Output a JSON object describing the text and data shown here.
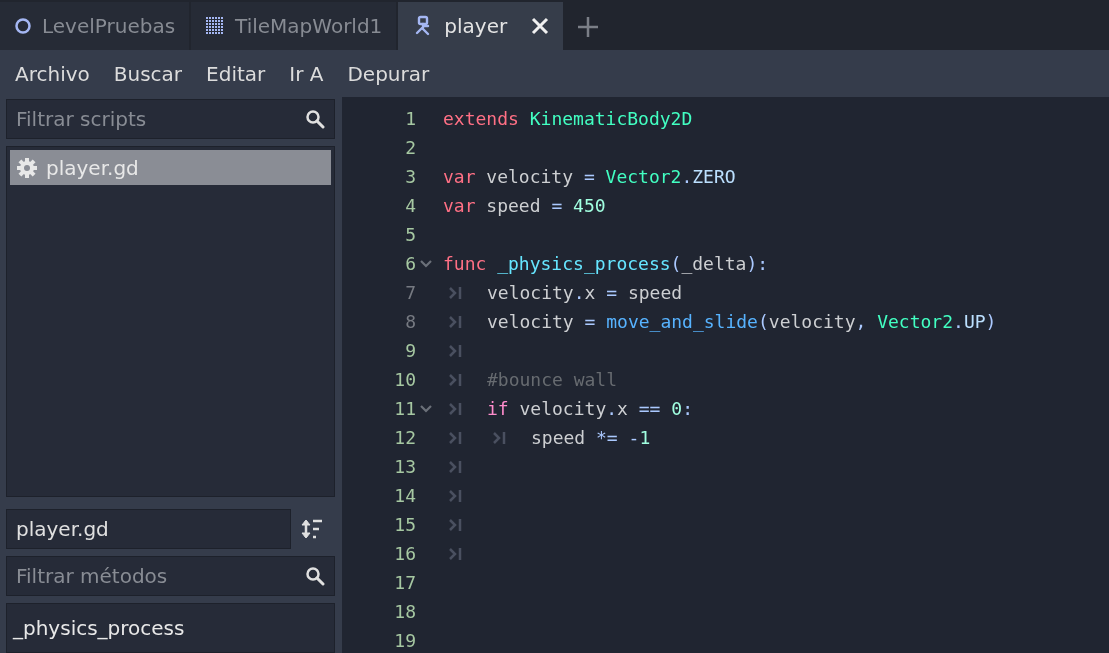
{
  "tabs": [
    {
      "label": "LevelPruebas",
      "selected": false
    },
    {
      "label": "TileMapWorld1",
      "selected": false
    },
    {
      "label": "player",
      "selected": true
    }
  ],
  "menu": [
    "Archivo",
    "Buscar",
    "Editar",
    "Ir A",
    "Depurar"
  ],
  "scripts_panel": {
    "filter": {
      "placeholder": "Filtrar scripts"
    },
    "items": [
      {
        "label": "player.gd",
        "selected": true
      }
    ]
  },
  "methods_panel": {
    "current_script": "player.gd",
    "filter": {
      "placeholder": "Filtrar métodos"
    },
    "items": [
      {
        "label": "_physics_process",
        "selected": false
      }
    ]
  },
  "editor": {
    "lines": [
      {
        "number": "1",
        "foldable": false,
        "dimmed": false,
        "tokens": [
          {
            "kind": "keyword",
            "text": "extends "
          },
          {
            "kind": "type",
            "text": "KinematicBody2D"
          }
        ]
      },
      {
        "number": "2",
        "foldable": false,
        "dimmed": false
      },
      {
        "number": "3",
        "foldable": false,
        "dimmed": false,
        "tokens": [
          {
            "kind": "keyword",
            "text": "var"
          },
          {
            "kind": "text",
            "text": " velocity "
          },
          {
            "kind": "symbol",
            "text": "= "
          },
          {
            "kind": "type",
            "text": "Vector2"
          },
          {
            "kind": "symbol",
            "text": "."
          },
          {
            "kind": "member",
            "text": "ZERO"
          }
        ]
      },
      {
        "number": "4",
        "foldable": false,
        "dimmed": false,
        "tokens": [
          {
            "kind": "keyword",
            "text": "var"
          },
          {
            "kind": "text",
            "text": " speed "
          },
          {
            "kind": "symbol",
            "text": "= "
          },
          {
            "kind": "number",
            "text": "450"
          }
        ]
      },
      {
        "number": "5",
        "foldable": false,
        "dimmed": false
      },
      {
        "number": "6",
        "foldable": true,
        "dimmed": false,
        "tokens": [
          {
            "kind": "keyword",
            "text": "func "
          },
          {
            "kind": "member_function",
            "text": "_physics_process"
          },
          {
            "kind": "symbol",
            "text": "("
          },
          {
            "kind": "text",
            "text": "_delta"
          },
          {
            "kind": "symbol",
            "text": "):"
          }
        ]
      },
      {
        "number": "7",
        "foldable": false,
        "dimmed": true,
        "tokens": [
          {
            "kind": "tab"
          },
          {
            "kind": "text",
            "text": "velocity"
          },
          {
            "kind": "symbol",
            "text": "."
          },
          {
            "kind": "text",
            "text": "x "
          },
          {
            "kind": "symbol",
            "text": "="
          },
          {
            "kind": "text",
            "text": " speed"
          }
        ]
      },
      {
        "number": "8",
        "foldable": false,
        "dimmed": true,
        "tokens": [
          {
            "kind": "tab"
          },
          {
            "kind": "text",
            "text": "velocity "
          },
          {
            "kind": "symbol",
            "text": "= "
          },
          {
            "kind": "function",
            "text": "move_and_slide"
          },
          {
            "kind": "symbol",
            "text": "("
          },
          {
            "kind": "text",
            "text": "velocity"
          },
          {
            "kind": "symbol",
            "text": ", "
          },
          {
            "kind": "type",
            "text": "Vector2"
          },
          {
            "kind": "symbol",
            "text": "."
          },
          {
            "kind": "member",
            "text": "UP"
          },
          {
            "kind": "symbol",
            "text": ")"
          }
        ]
      },
      {
        "number": "9",
        "foldable": false,
        "dimmed": false,
        "tokens": [
          {
            "kind": "tab"
          }
        ]
      },
      {
        "number": "10",
        "foldable": false,
        "dimmed": false,
        "tokens": [
          {
            "kind": "tab"
          },
          {
            "kind": "comment",
            "text": "#bounce wall"
          }
        ]
      },
      {
        "number": "11",
        "foldable": true,
        "dimmed": false,
        "tokens": [
          {
            "kind": "tab"
          },
          {
            "kind": "control",
            "text": "if"
          },
          {
            "kind": "text",
            "text": " velocity"
          },
          {
            "kind": "symbol",
            "text": "."
          },
          {
            "kind": "text",
            "text": "x "
          },
          {
            "kind": "symbol",
            "text": "== "
          },
          {
            "kind": "number",
            "text": "0"
          },
          {
            "kind": "symbol",
            "text": ":"
          }
        ]
      },
      {
        "number": "12",
        "foldable": false,
        "dimmed": false,
        "tokens": [
          {
            "kind": "tab"
          },
          {
            "kind": "tab"
          },
          {
            "kind": "text",
            "text": "speed "
          },
          {
            "kind": "symbol",
            "text": "*= -"
          },
          {
            "kind": "number",
            "text": "1"
          }
        ]
      },
      {
        "number": "13",
        "foldable": false,
        "dimmed": false,
        "tokens": [
          {
            "kind": "tab"
          }
        ]
      },
      {
        "number": "14",
        "foldable": false,
        "dimmed": false,
        "tokens": [
          {
            "kind": "tab"
          }
        ]
      },
      {
        "number": "15",
        "foldable": false,
        "dimmed": false,
        "tokens": [
          {
            "kind": "tab"
          }
        ]
      },
      {
        "number": "16",
        "foldable": false,
        "dimmed": false,
        "tokens": [
          {
            "kind": "tab"
          }
        ]
      },
      {
        "number": "17",
        "foldable": false,
        "dimmed": false
      },
      {
        "number": "18",
        "foldable": false,
        "dimmed": false
      },
      {
        "number": "19",
        "foldable": false,
        "dimmed": false
      }
    ]
  }
}
